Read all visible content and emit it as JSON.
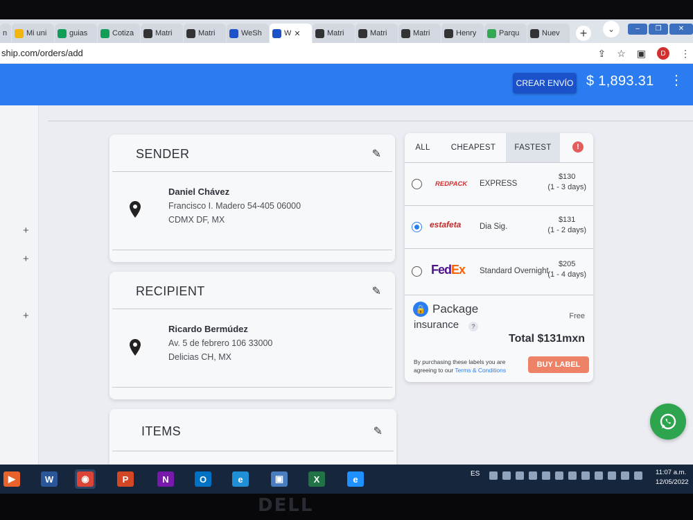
{
  "browser": {
    "tabs": [
      {
        "title": "n",
        "icon": "doc-icon",
        "color": "#5f6b7a"
      },
      {
        "title": "Mi uni",
        "icon": "drive-icon",
        "color": "#f2b50a"
      },
      {
        "title": "guias",
        "icon": "sheets-icon",
        "color": "#0f9d58"
      },
      {
        "title": "Cotiza",
        "icon": "sheets-icon",
        "color": "#0f9d58"
      },
      {
        "title": "Matri",
        "icon": "globe-icon",
        "color": "#333333"
      },
      {
        "title": "Matri",
        "icon": "globe-icon",
        "color": "#333333"
      },
      {
        "title": "WeSh",
        "icon": "weship-icon",
        "color": "#1b52c9"
      },
      {
        "title": "W",
        "icon": "weship-icon",
        "color": "#1b52c9",
        "active": true
      },
      {
        "title": "Matri",
        "icon": "globe-icon",
        "color": "#333333"
      },
      {
        "title": "Matri",
        "icon": "globe-icon",
        "color": "#333333"
      },
      {
        "title": "Matri",
        "icon": "globe-icon",
        "color": "#333333"
      },
      {
        "title": "Henry",
        "icon": "wikipedia-icon",
        "color": "#333333"
      },
      {
        "title": "Parqu",
        "icon": "maps-icon",
        "color": "#34a853"
      },
      {
        "title": "Nuev",
        "icon": "chrome-icon",
        "color": "#333333"
      }
    ],
    "close_glyph": "✕",
    "new_tab_glyph": "+",
    "url": "ship.com/orders/add",
    "profile_initial": "D"
  },
  "header": {
    "create_label": "CREAR ENVÍO",
    "balance": "$ 1,893.31",
    "menu_glyph": "⋮",
    "colors": {
      "primary": "#2a7cf0",
      "button": "#1b52c9"
    }
  },
  "sidebar": {
    "plus_glyph": "+"
  },
  "sender": {
    "title": "SENDER",
    "name": "Daniel Chávez",
    "address1": "Francisco I. Madero 54-405 06000",
    "address2": "CDMX DF, MX"
  },
  "recipient": {
    "title": "RECIPIENT",
    "name": "Ricardo Bermúdez",
    "address1": "Av. 5 de febrero 106 33000",
    "address2": "Delicias CH, MX"
  },
  "items": {
    "title": "ITEMS"
  },
  "rates": {
    "tabs": [
      "ALL",
      "CHEAPEST",
      "FASTEST"
    ],
    "selected_tab": "FASTEST",
    "warning_glyph": "!",
    "options": [
      {
        "carrier": "REDPACK",
        "service": "EXPRESS",
        "price": "$130",
        "eta": "(1 - 3 days)",
        "selected": false
      },
      {
        "carrier": "estafeta",
        "service": "Dia Sig.",
        "price": "$131",
        "eta": "(1 - 2 days)",
        "selected": true
      },
      {
        "carrier_a": "Fed",
        "carrier_b": "Ex",
        "service": "Standard Overnight",
        "price": "$205",
        "eta": "(1 - 4 days)",
        "selected": false
      }
    ],
    "insurance_line1": "Package",
    "insurance_line2": "insurance",
    "help_glyph": "?",
    "insurance_price": "Free",
    "total": "Total $131mxn",
    "terms_text": "By purchasing these labels you are agreeing to our ",
    "terms_link": "Terms & Conditions",
    "buy_label": "BUY LABEL",
    "colors": {
      "buy": "#ee8266",
      "redpack": "#d32f2f",
      "estafeta": "#c62828",
      "fedex_purple": "#4d148c",
      "fedex_orange": "#ff6200"
    }
  },
  "taskbar": {
    "lang": "ES",
    "time": "11:07 a.m.",
    "date": "12/05/2022",
    "apps": [
      {
        "label": "▶",
        "color": "#e8632b"
      },
      {
        "label": "W",
        "color": "#2b579a"
      },
      {
        "label": "◉",
        "color": "#db4437",
        "active": true
      },
      {
        "label": "P",
        "color": "#d24726"
      },
      {
        "label": "N",
        "color": "#7719aa"
      },
      {
        "label": "O",
        "color": "#0072c6"
      },
      {
        "label": "e",
        "color": "#1f8fd6"
      },
      {
        "label": "▣",
        "color": "#4a7dbf"
      },
      {
        "label": "X",
        "color": "#217346"
      },
      {
        "label": "e",
        "color": "#1e90ff"
      }
    ]
  }
}
